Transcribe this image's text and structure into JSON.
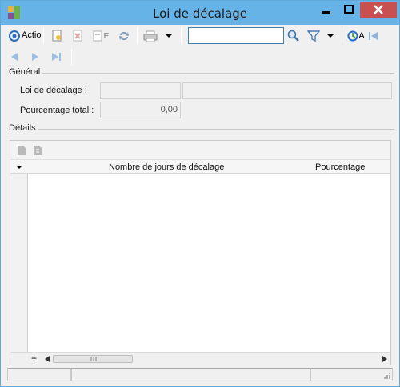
{
  "window": {
    "title": "Loi de décalage"
  },
  "toolbar": {
    "action_label": "Actio",
    "search_value": "",
    "filter_suffix": "A",
    "e_label": "E"
  },
  "general": {
    "section_title": "Général",
    "loi_label": "Loi de décalage :",
    "loi_code_value": "",
    "loi_desc_value": "",
    "pourcentage_label": "Pourcentage total :",
    "pourcentage_value": "0,00"
  },
  "details": {
    "section_title": "Détails",
    "columns": [
      "Nombre de jours de décalage",
      "Pourcentage"
    ],
    "rows": [],
    "add_symbol": "+"
  },
  "colors": {
    "titlebar": "#66b3e8",
    "close_button": "#c75050",
    "window_bg": "#f0f0f0"
  }
}
